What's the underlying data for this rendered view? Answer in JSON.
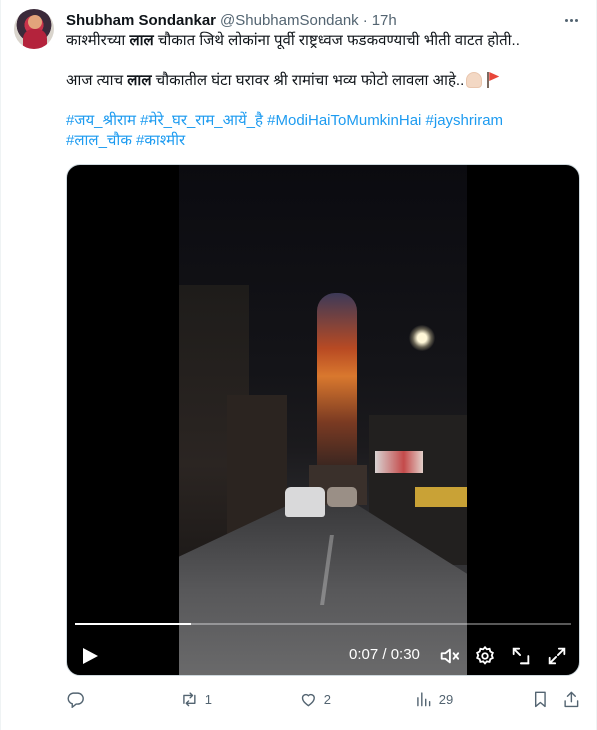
{
  "tweet": {
    "author_name": "Shubham Sondankar",
    "author_handle": "@ShubhamSondank",
    "separator": "·",
    "time": "17h",
    "line1": "काश्मीरच्या लाल चौकात जिथे लोकांना पूर्वी राष्ट्रध्वज फडकवण्याची भीती वाटत होती..",
    "line1_a": "काश्मीरच्या ",
    "line1_b": "लाल",
    "line1_c": " चौकात जिथे लोकांना पूर्वी राष्ट्रध्वज फडकवण्याची भीती वाटत होती..",
    "line2_a": "आज त्याच ",
    "line2_b": "लाल",
    "line2_c": " चौकातील घंटा घरावर श्री रामांचा भव्य फोटो लावला आहे..",
    "hashtags_line1": "#जय_श्रीराम #मेरे_घर_राम_आयें_है #ModiHaiToMumkinHai #jayshriram",
    "hashtags_line2": "#लाल_चौक #काश्मीर"
  },
  "video": {
    "time_display": "0:07 / 0:30",
    "progress": 0.2333
  },
  "actions": {
    "replies": "",
    "reposts": "1",
    "likes": "2",
    "views": "29"
  },
  "colors": {
    "link": "#1d9bf0",
    "secondary_text": "#536471",
    "primary_text": "#0f1419"
  },
  "icons": [
    "more-icon",
    "play-icon",
    "mute-icon",
    "settings-icon",
    "pip-icon",
    "fullscreen-icon",
    "reply-icon",
    "repost-icon",
    "like-icon",
    "views-icon",
    "bookmark-icon",
    "share-icon"
  ]
}
